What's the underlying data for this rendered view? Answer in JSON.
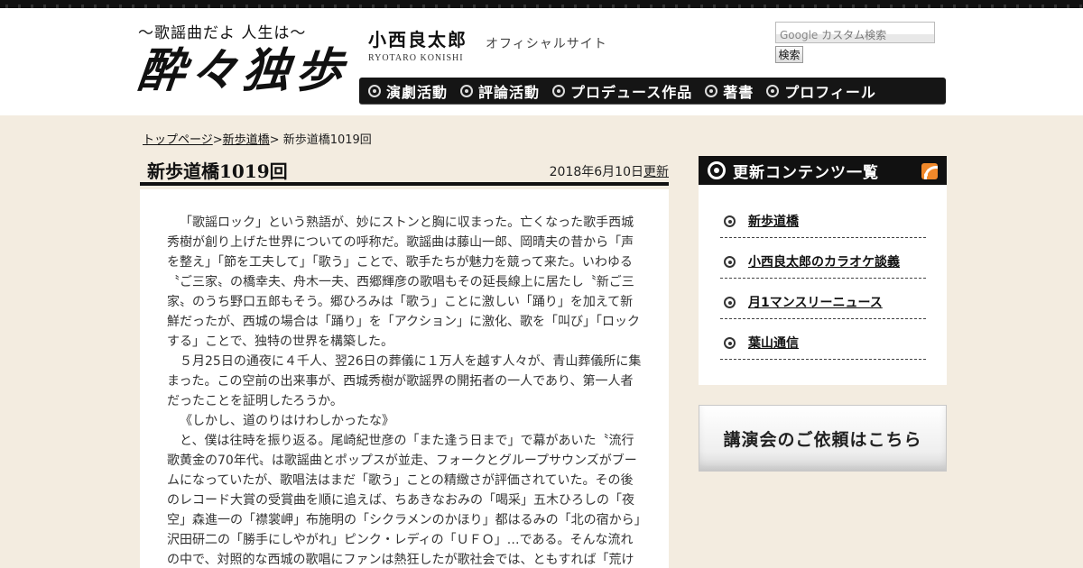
{
  "header": {
    "logo_tagline": "〜歌謡曲だよ 人生は〜",
    "logo_main": "酔々独歩",
    "owner_name": "小西良太郎",
    "owner_roman": "RYOTARO KONISHI",
    "owner_subtitle": "オフィシャルサイト"
  },
  "search": {
    "placeholder_brand": "Google",
    "placeholder_text": "カスタム検索",
    "button_label": "検索"
  },
  "nav": {
    "items": [
      {
        "label": "演劇活動"
      },
      {
        "label": "評論活動"
      },
      {
        "label": "プロデュース作品"
      },
      {
        "label": "著書"
      },
      {
        "label": "プロフィール"
      }
    ]
  },
  "breadcrumb": {
    "home": "トップページ",
    "sep1": ">",
    "section": "新歩道橋",
    "sep2": "> ",
    "current": "新歩道橋1019回"
  },
  "article": {
    "title": "新歩道橋1019回",
    "date": "2018年6月10日",
    "updated_label": "更新",
    "paragraphs": [
      "「歌謡ロック」という熟語が、妙にストンと胸に収まった。亡くなった歌手西城秀樹が創り上げた世界についての呼称だ。歌謡曲は藤山一郎、岡晴夫の昔から「声を整え」「節を工夫して」「歌う」ことで、歌手たちが魅力を競って来た。いわゆる〝ご三家〟の橋幸夫、舟木一夫、西郷輝彦の歌唱もその延長線上に居たし〝新ご三家〟のうち野口五郎もそう。郷ひろみは「歌う」ことに激しい「踊り」を加えて新鮮だったが、西城の場合は「踊り」を「アクション」に激化、歌を「叫び」「ロックする」ことで、独特の世界を構築した。",
      "５月25日の通夜に４千人、翌26日の葬儀に１万人を越す人々が、青山葬儀所に集まった。この空前の出来事が、西城秀樹が歌謡界の開拓者の一人であり、第一人者だったことを証明したろうか。",
      "《しかし、道のりはけわしかったな》",
      "と、僕は往時を振り返る。尾崎紀世彦の「また逢う日まで」で幕があいた〝流行歌黄金の70年代〟は歌謡曲とポップスが並走、フォークとグループサウンズがブームになっていたが、歌唱法はまだ「歌う」ことの精緻さが評価されていた。その後のレコード大賞の受賞曲を順に追えば、ちあきなおみの「喝采」五木ひろしの「夜空」森進一の「襟裳岬」布施明の「シクラメンのかほり」都はるみの「北の宿から」沢田研二の「勝手にしやがれ」ピンク・レディの「ＵＦＯ」…である。そんな流れの中で、対照的な西城の歌唱にファンは熱狂したが歌社会では、ともすれば「荒けずり」良く言って「ラフ」で「シャウトする」ロックスピリットが認められにく"
    ]
  },
  "sidebar": {
    "heading": "更新コンテンツ一覧",
    "items": [
      {
        "label": "新歩道橋"
      },
      {
        "label": "小西良太郎のカラオケ談義"
      },
      {
        "label": "月1マンスリーニュース"
      },
      {
        "label": "葉山通信"
      }
    ],
    "lecture_banner": "講演会のご依頼はこちら"
  }
}
